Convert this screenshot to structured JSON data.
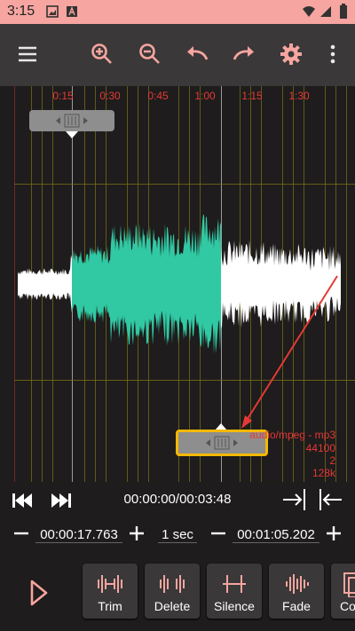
{
  "status": {
    "time": "3:15"
  },
  "toolbar": {
    "icons": [
      "menu-icon",
      "zoom-in-icon",
      "zoom-out-icon",
      "undo-icon",
      "redo-icon",
      "settings-icon",
      "more-icon"
    ],
    "accent": "#f6a5a0"
  },
  "timeline": {
    "ticks": [
      "0:15",
      "0:30",
      "0:45",
      "1:00",
      "1:15",
      "1:30"
    ]
  },
  "audio_info": {
    "format": "audio/mpeg - mp3",
    "rate": "44100",
    "channels": "2",
    "bitrate": "128k"
  },
  "playback": {
    "position": "00:00:00/00:03:48"
  },
  "selection": {
    "start": "00:00:17.763",
    "step": "1 sec",
    "end": "00:01:05.202"
  },
  "edit_buttons": [
    {
      "label": "Trim"
    },
    {
      "label": "Delete"
    },
    {
      "label": "Silence"
    },
    {
      "label": "Fade"
    },
    {
      "label": "Co"
    }
  ],
  "colors": {
    "waveform": "#ffffff",
    "selection": "#30c9a4",
    "grid": "#7b6e1a",
    "marker_active": "#f5b800",
    "tick_text": "#e53935"
  }
}
